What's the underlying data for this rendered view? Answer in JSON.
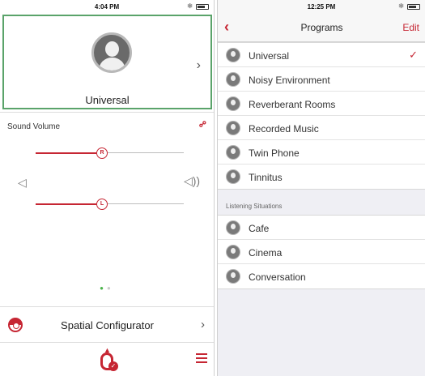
{
  "left_screen": {
    "status_time": "4:04 PM",
    "program_card": {
      "name": "Universal",
      "chevron": "›"
    },
    "volume": {
      "label": "Sound Volume",
      "right_knob": "R",
      "left_knob": "L",
      "right_level": 0.45,
      "left_level": 0.45
    },
    "spatial": {
      "label": "Spatial Configurator",
      "chevron": "›"
    },
    "icons": {
      "link": "link-icon",
      "speaker_low": "speaker-low-icon",
      "speaker_high": "speaker-high-icon",
      "hearing": "hearing-aid-icon",
      "menu": "hamburger-menu-icon"
    },
    "page_dots": {
      "active": 0,
      "count": 2
    }
  },
  "right_screen": {
    "status_time": "12:25 PM",
    "nav": {
      "back": "‹",
      "title": "Programs",
      "edit": "Edit"
    },
    "programs": [
      {
        "label": "Universal",
        "checked": true
      },
      {
        "label": "Noisy Environment"
      },
      {
        "label": "Reverberant Rooms"
      },
      {
        "label": "Recorded Music"
      },
      {
        "label": "Twin Phone"
      },
      {
        "label": "Tinnitus"
      }
    ],
    "section_label": "Listening Situations",
    "situations": [
      {
        "label": "Cafe"
      },
      {
        "label": "Cinema"
      },
      {
        "label": "Conversation"
      }
    ],
    "check_mark": "✓"
  },
  "colors": {
    "accent": "#c62633",
    "card_border": "#5aa36a",
    "dot_active": "#4bb34b"
  }
}
